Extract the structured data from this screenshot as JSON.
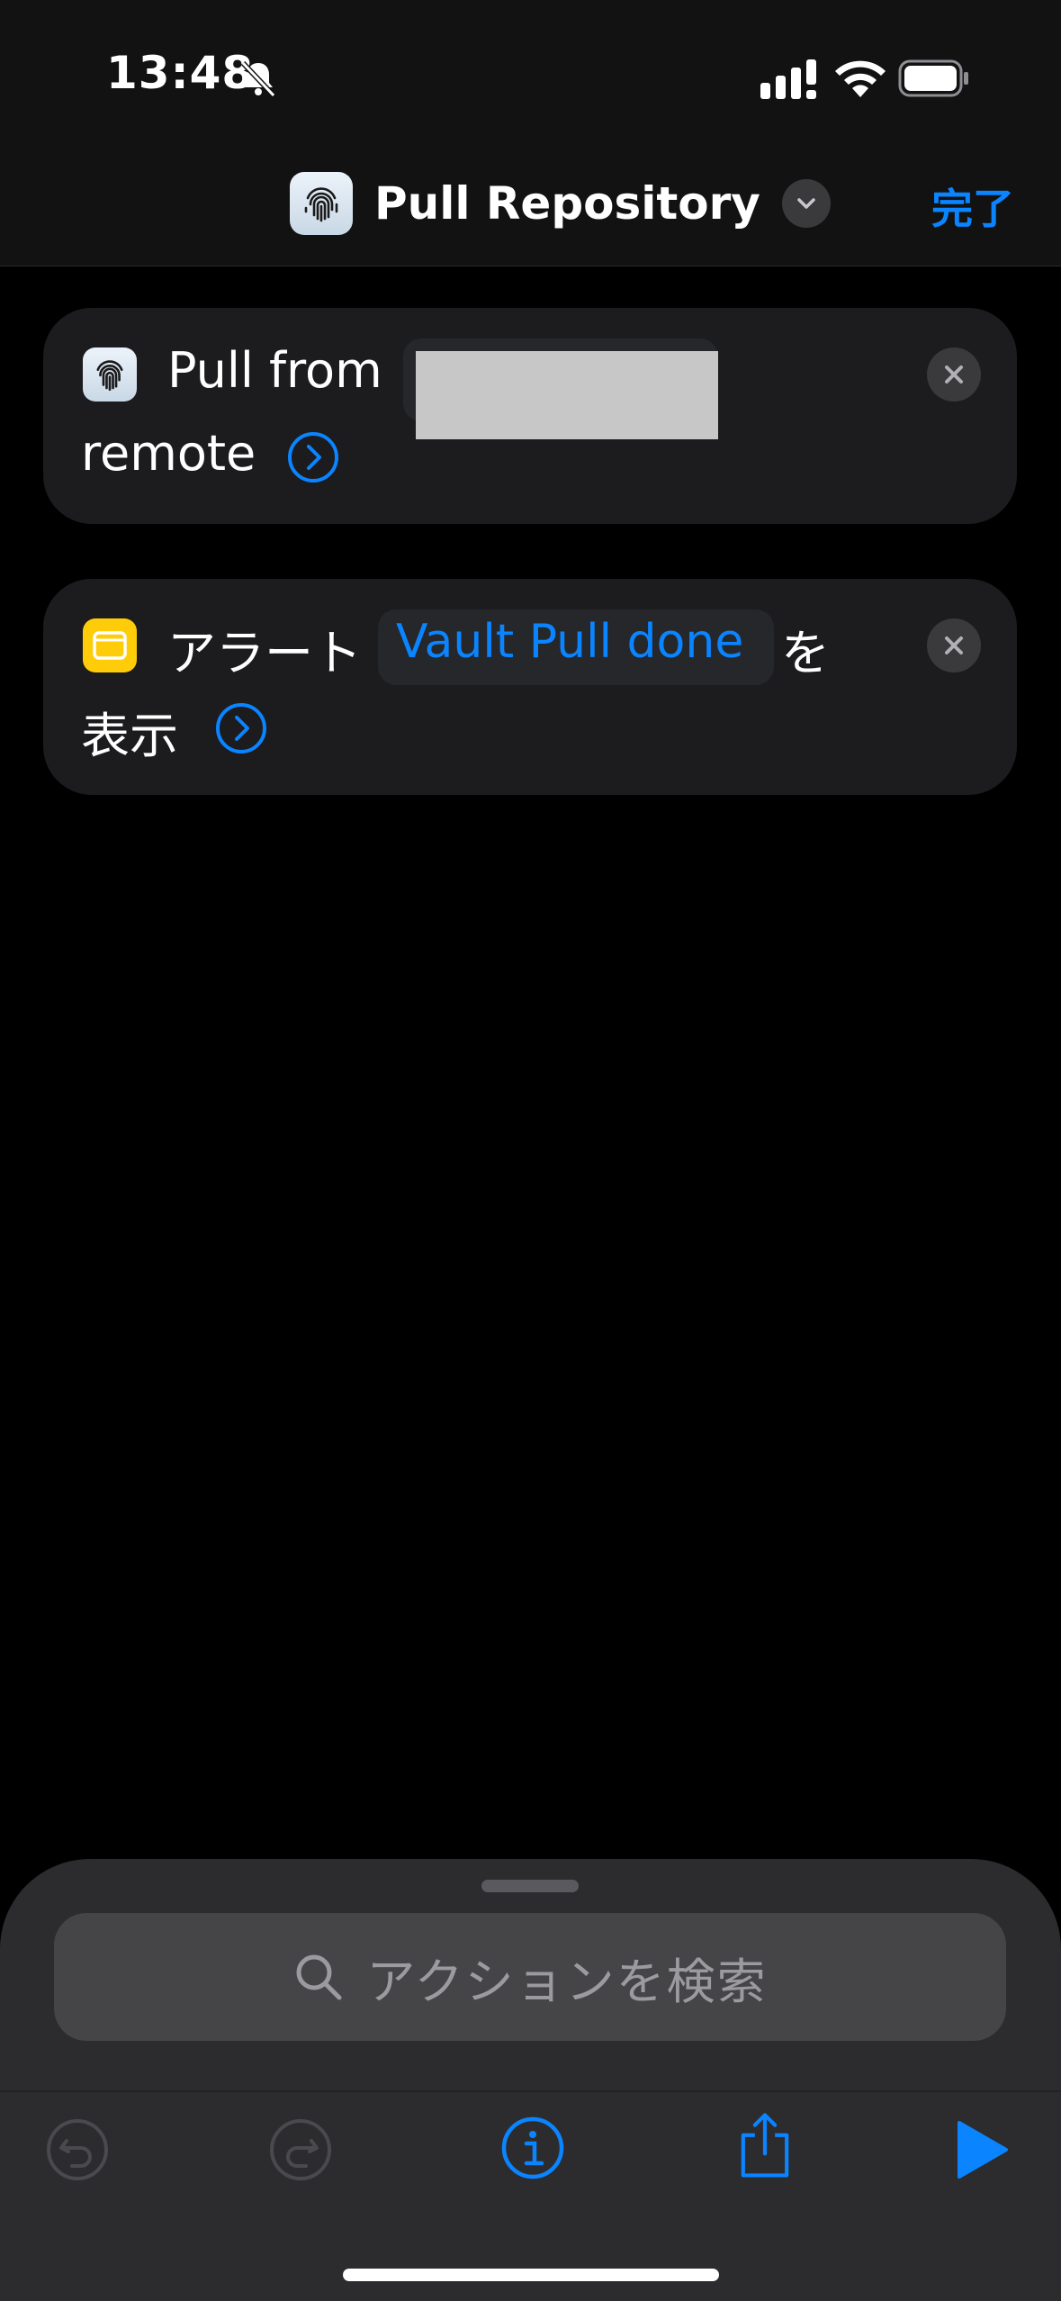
{
  "status_bar": {
    "time": "13:48",
    "icons": [
      "bell-slash-icon",
      "cellular-signal-icon",
      "wifi-icon",
      "battery-icon"
    ]
  },
  "header": {
    "title": "Pull Repository",
    "done_label": "完了",
    "app_icon": "fingerprint-icon"
  },
  "actions": [
    {
      "icon": "fingerprint-icon",
      "prefix": "Pull from",
      "parameter_redacted": true,
      "suffix": "remote"
    },
    {
      "icon": "alert-window-icon",
      "prefix": "アラート",
      "parameter": "Vault Pull done",
      "suffix_inline": "を",
      "suffix": "表示"
    }
  ],
  "search": {
    "placeholder": "アクションを検索"
  },
  "toolbar": {
    "items": [
      "undo-icon",
      "redo-icon",
      "info-icon",
      "share-icon",
      "play-icon"
    ]
  },
  "colors": {
    "accent": "#0a84ff",
    "card_bg": "#1c1c1e",
    "sheet_bg": "#2c2c2e",
    "alert_icon": "#ffcc0a"
  }
}
